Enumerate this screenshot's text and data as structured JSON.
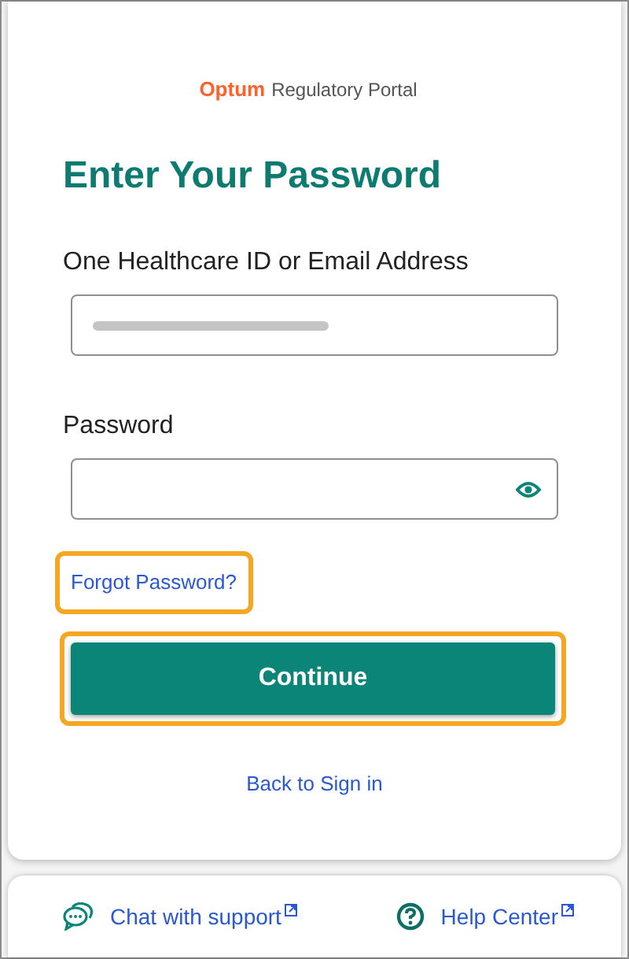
{
  "header": {
    "brand": "Optum",
    "product": "Regulatory Portal"
  },
  "title": "Enter Your Password",
  "fields": [
    {
      "kind": "text",
      "label": "One Healthcare ID or Email Address",
      "redacted": true
    },
    {
      "kind": "password",
      "label": "Password"
    }
  ],
  "forgot_link": {
    "label": "Forgot Password?",
    "highlighted": true
  },
  "continue_button": {
    "label": "Continue",
    "highlighted": true
  },
  "back_link": {
    "label": "Back to Sign in"
  },
  "footer": [
    {
      "kind": "chat",
      "label": "Chat with support"
    },
    {
      "kind": "help",
      "label": "Help Center"
    }
  ]
}
